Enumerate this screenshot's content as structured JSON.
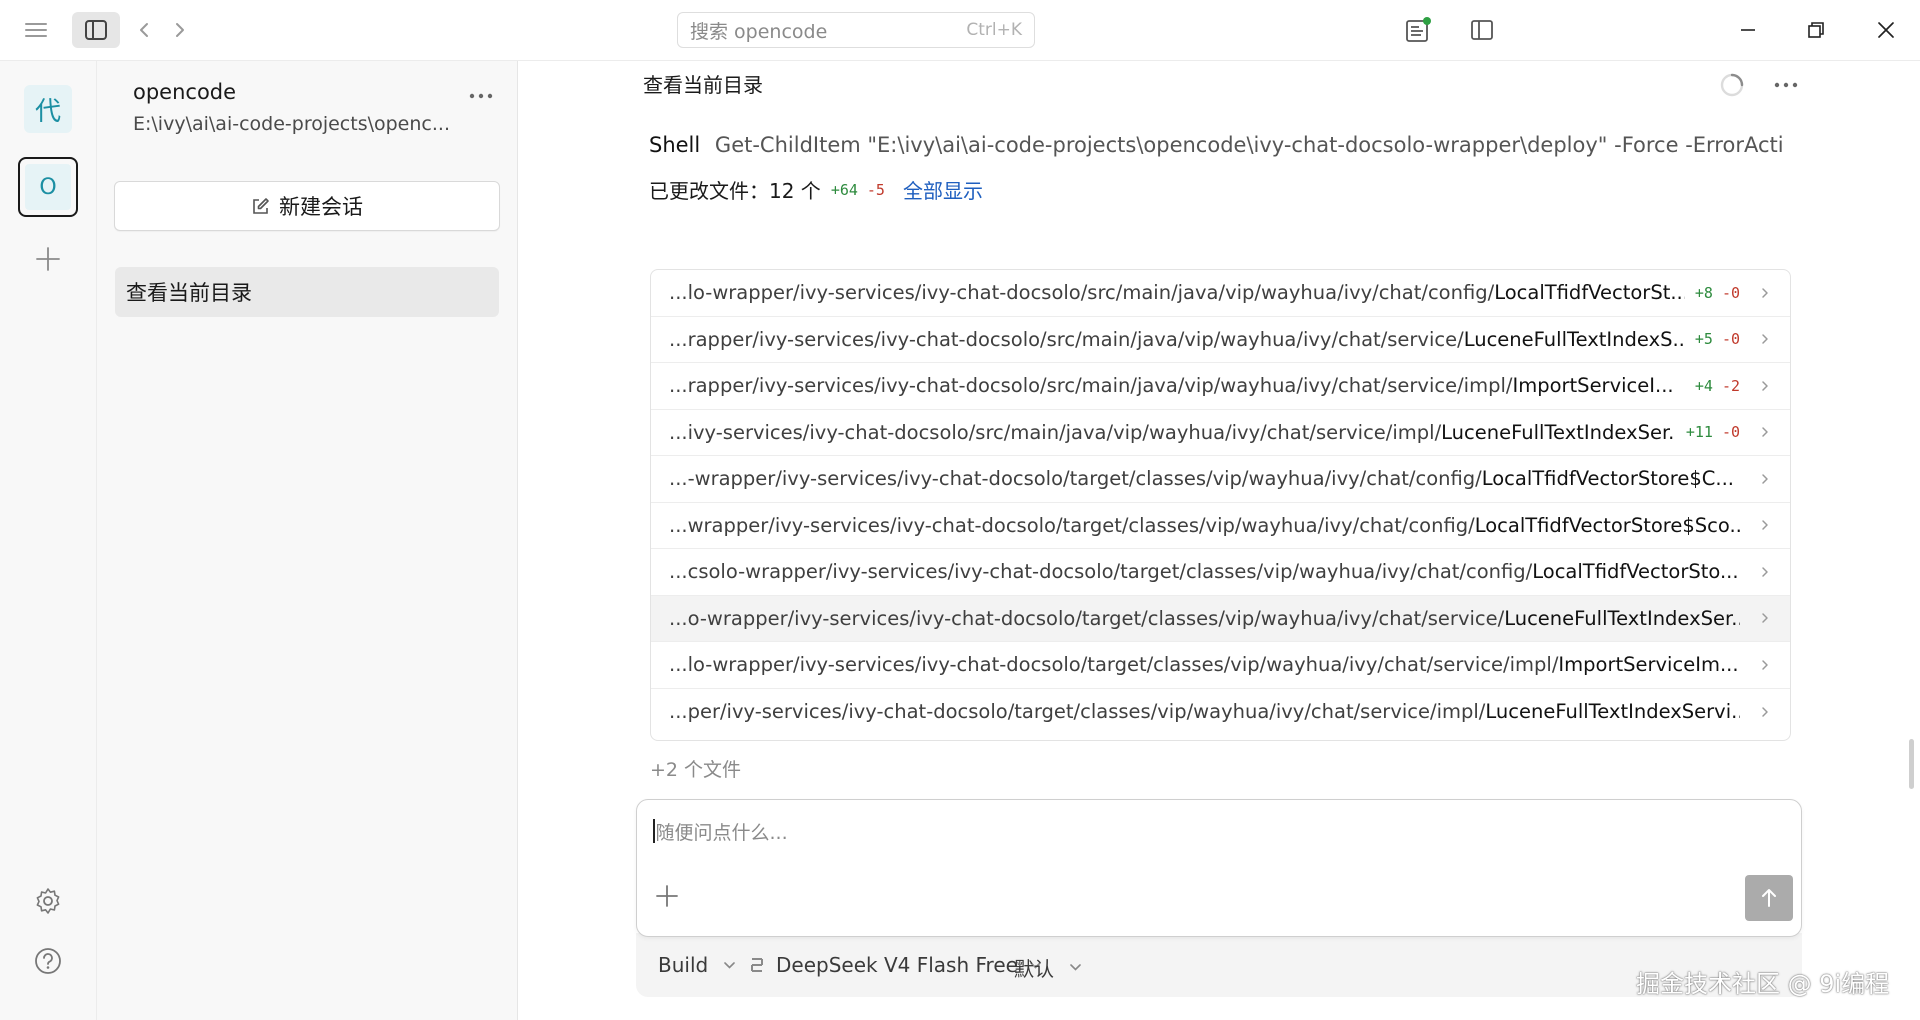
{
  "titlebar": {
    "search_placeholder": "搜索 opencode",
    "search_shortcut": "Ctrl+K",
    "notification_dot_color": "#2ea043"
  },
  "rail": {
    "projects": [
      {
        "label": "代",
        "active": false
      },
      {
        "label": "O",
        "active": true
      }
    ]
  },
  "sidebar": {
    "project_name": "opencode",
    "project_path": "E:\\ivy\\ai\\ai-code-projects\\openc...",
    "new_session_label": "新建会话",
    "sessions": [
      {
        "title": "查看当前目录",
        "selected": true
      }
    ]
  },
  "main": {
    "title": "查看当前目录",
    "shell_label": "Shell",
    "shell_command": "Get-ChildItem \"E:\\ivy\\ai\\ai-code-projects\\opencode\\ivy-chat-docsolo-wrapper\\deploy\" -Force -ErrorActi",
    "changed_label": "已更改文件：",
    "changed_count": "12 个",
    "changed_added": "+64",
    "changed_removed": "-5",
    "show_all_label": "全部显示",
    "files": [
      {
        "dir": "...lo-wrapper/ivy-services/ivy-chat-docsolo/src/main/java/vip/wayhua/ivy/chat/config/",
        "name": "LocalTfidfVectorSt...",
        "add": "+8",
        "del": "-0",
        "highlighted": false
      },
      {
        "dir": "...rapper/ivy-services/ivy-chat-docsolo/src/main/java/vip/wayhua/ivy/chat/service/",
        "name": "LuceneFullTextIndexS...",
        "add": "+5",
        "del": "-0",
        "highlighted": false
      },
      {
        "dir": "...rapper/ivy-services/ivy-chat-docsolo/src/main/java/vip/wayhua/ivy/chat/service/impl/",
        "name": "ImportServiceI...",
        "add": "+4",
        "del": "-2",
        "highlighted": false
      },
      {
        "dir": "...ivy-services/ivy-chat-docsolo/src/main/java/vip/wayhua/ivy/chat/service/impl/",
        "name": "LuceneFullTextIndexSer...",
        "add": "+11",
        "del": "-0",
        "highlighted": false
      },
      {
        "dir": "...-wrapper/ivy-services/ivy-chat-docsolo/target/classes/vip/wayhua/ivy/chat/config/",
        "name": "LocalTfidfVectorStore$C...",
        "add": "",
        "del": "",
        "highlighted": false
      },
      {
        "dir": "...wrapper/ivy-services/ivy-chat-docsolo/target/classes/vip/wayhua/ivy/chat/config/",
        "name": "LocalTfidfVectorStore$Sco...",
        "add": "",
        "del": "",
        "highlighted": false
      },
      {
        "dir": "...csolo-wrapper/ivy-services/ivy-chat-docsolo/target/classes/vip/wayhua/ivy/chat/config/",
        "name": "LocalTfidfVectorSto...",
        "add": "",
        "del": "",
        "highlighted": false
      },
      {
        "dir": "...o-wrapper/ivy-services/ivy-chat-docsolo/target/classes/vip/wayhua/ivy/chat/service/",
        "name": "LuceneFullTextIndexSer...",
        "add": "",
        "del": "",
        "highlighted": true
      },
      {
        "dir": "...lo-wrapper/ivy-services/ivy-chat-docsolo/target/classes/vip/wayhua/ivy/chat/service/impl/",
        "name": "ImportServiceIm...",
        "add": "",
        "del": "",
        "highlighted": false
      },
      {
        "dir": "...per/ivy-services/ivy-chat-docsolo/target/classes/vip/wayhua/ivy/chat/service/impl/",
        "name": "LuceneFullTextIndexServi...",
        "add": "",
        "del": "",
        "highlighted": false
      }
    ],
    "more_files": "+2 个文件",
    "composer_placeholder": "随便问点什么...",
    "agent_mode": "Build",
    "model": "DeepSeek V4 Flash Free",
    "variant": "默认"
  },
  "watermark": "掘金技术社区 @ 9i编程"
}
